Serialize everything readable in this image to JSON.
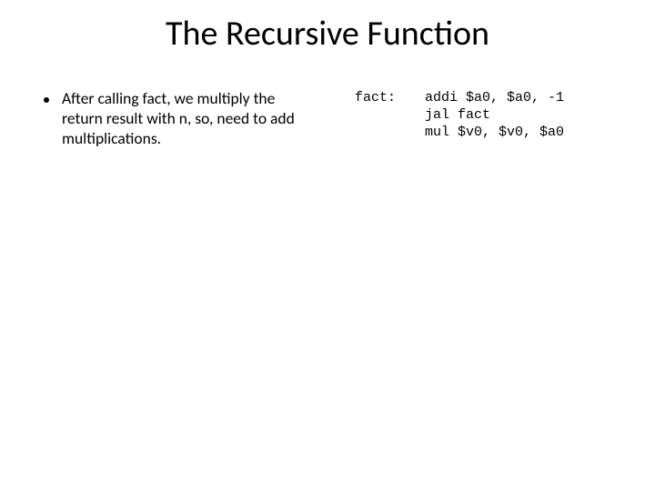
{
  "title": "The Recursive Function",
  "bullet": "After calling fact, we multiply the return result with n, so, need to add multiplications.",
  "code": {
    "label": "fact:",
    "line1": "addi $a0, $a0, -1",
    "line2": "jal fact",
    "line3": "mul $v0, $v0, $a0"
  }
}
